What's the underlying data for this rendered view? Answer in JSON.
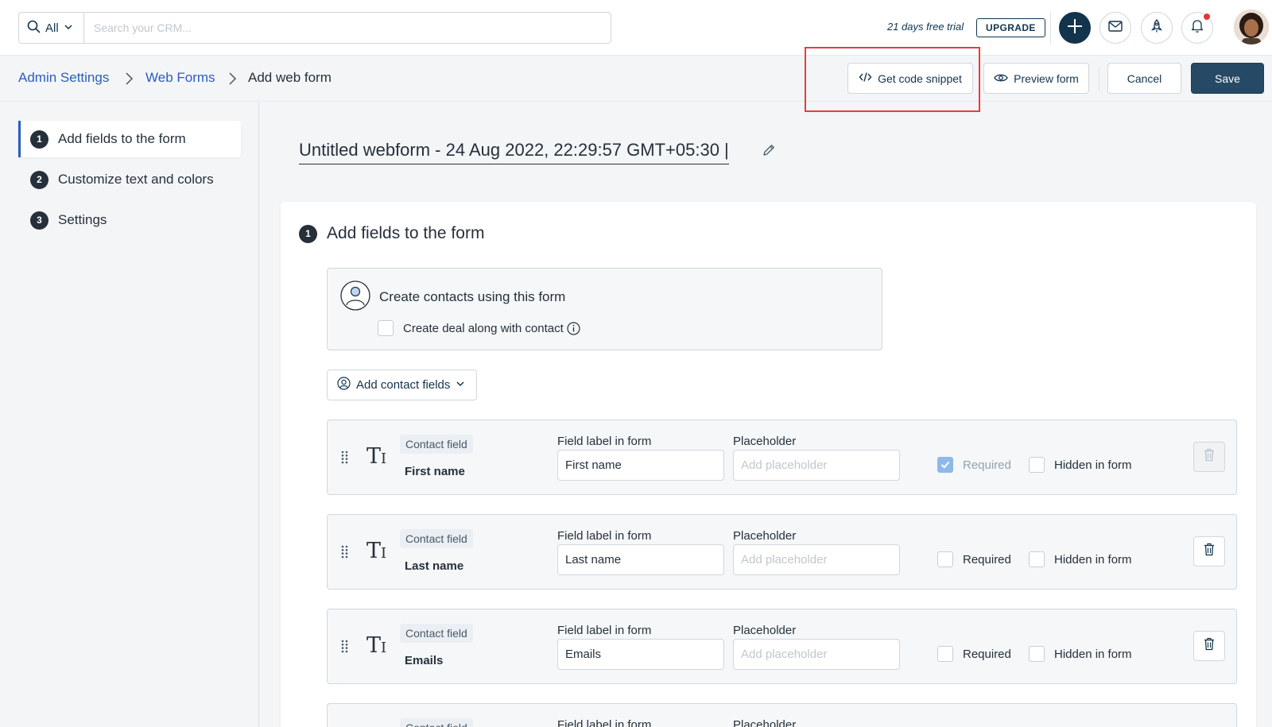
{
  "search": {
    "scope_label": "All",
    "placeholder": "Search your CRM...",
    "value": ""
  },
  "topbar": {
    "trial_text": "21 days free trial",
    "upgrade_label": "UPGRADE",
    "icons": [
      "plus-icon",
      "mail-icon",
      "rocket-icon",
      "bell-icon"
    ],
    "notification_dot_color": "#e43538"
  },
  "breadcrumb": {
    "items": [
      "Admin Settings",
      "Web Forms",
      "Add web form"
    ]
  },
  "actions": {
    "snippet_label": "Get code snippet",
    "preview_label": "Preview form",
    "cancel_label": "Cancel",
    "save_label": "Save"
  },
  "sidebar": {
    "steps": [
      {
        "num": "1",
        "label": "Add fields to the form"
      },
      {
        "num": "2",
        "label": "Customize text and colors"
      },
      {
        "num": "3",
        "label": "Settings"
      }
    ]
  },
  "form": {
    "title": "Untitled webform - 24 Aug 2022, 22:29:57 GMT+05:30 |"
  },
  "section": {
    "num": "1",
    "title": "Add fields to the form",
    "contacts_title": "Create contacts using this form",
    "deal_label": "Create deal along with contact",
    "add_fields_label": "Add contact fields"
  },
  "fields": [
    {
      "tag": "Contact field",
      "name": "First name",
      "label_header": "Field label in form",
      "label_value": "First name",
      "placeholder_header": "Placeholder",
      "placeholder_hint": "Add placeholder",
      "required_label": "Required",
      "required": true,
      "hidden_label": "Hidden in form",
      "hidden": false
    },
    {
      "tag": "Contact field",
      "name": "Last name",
      "label_header": "Field label in form",
      "label_value": "Last name",
      "placeholder_header": "Placeholder",
      "placeholder_hint": "Add placeholder",
      "required_label": "Required",
      "required": false,
      "hidden_label": "Hidden in form",
      "hidden": false
    },
    {
      "tag": "Contact field",
      "name": "Emails",
      "label_header": "Field label in form",
      "label_value": "Emails",
      "placeholder_header": "Placeholder",
      "placeholder_hint": "Add placeholder",
      "required_label": "Required",
      "required": false,
      "hidden_label": "Hidden in form",
      "hidden": false
    },
    {
      "tag": "Contact field",
      "label_header": "Field label in form",
      "placeholder_header": "Placeholder"
    }
  ],
  "colors": {
    "primary": "#264966",
    "link": "#2c5cc5",
    "highlight": "#e93c3c"
  }
}
